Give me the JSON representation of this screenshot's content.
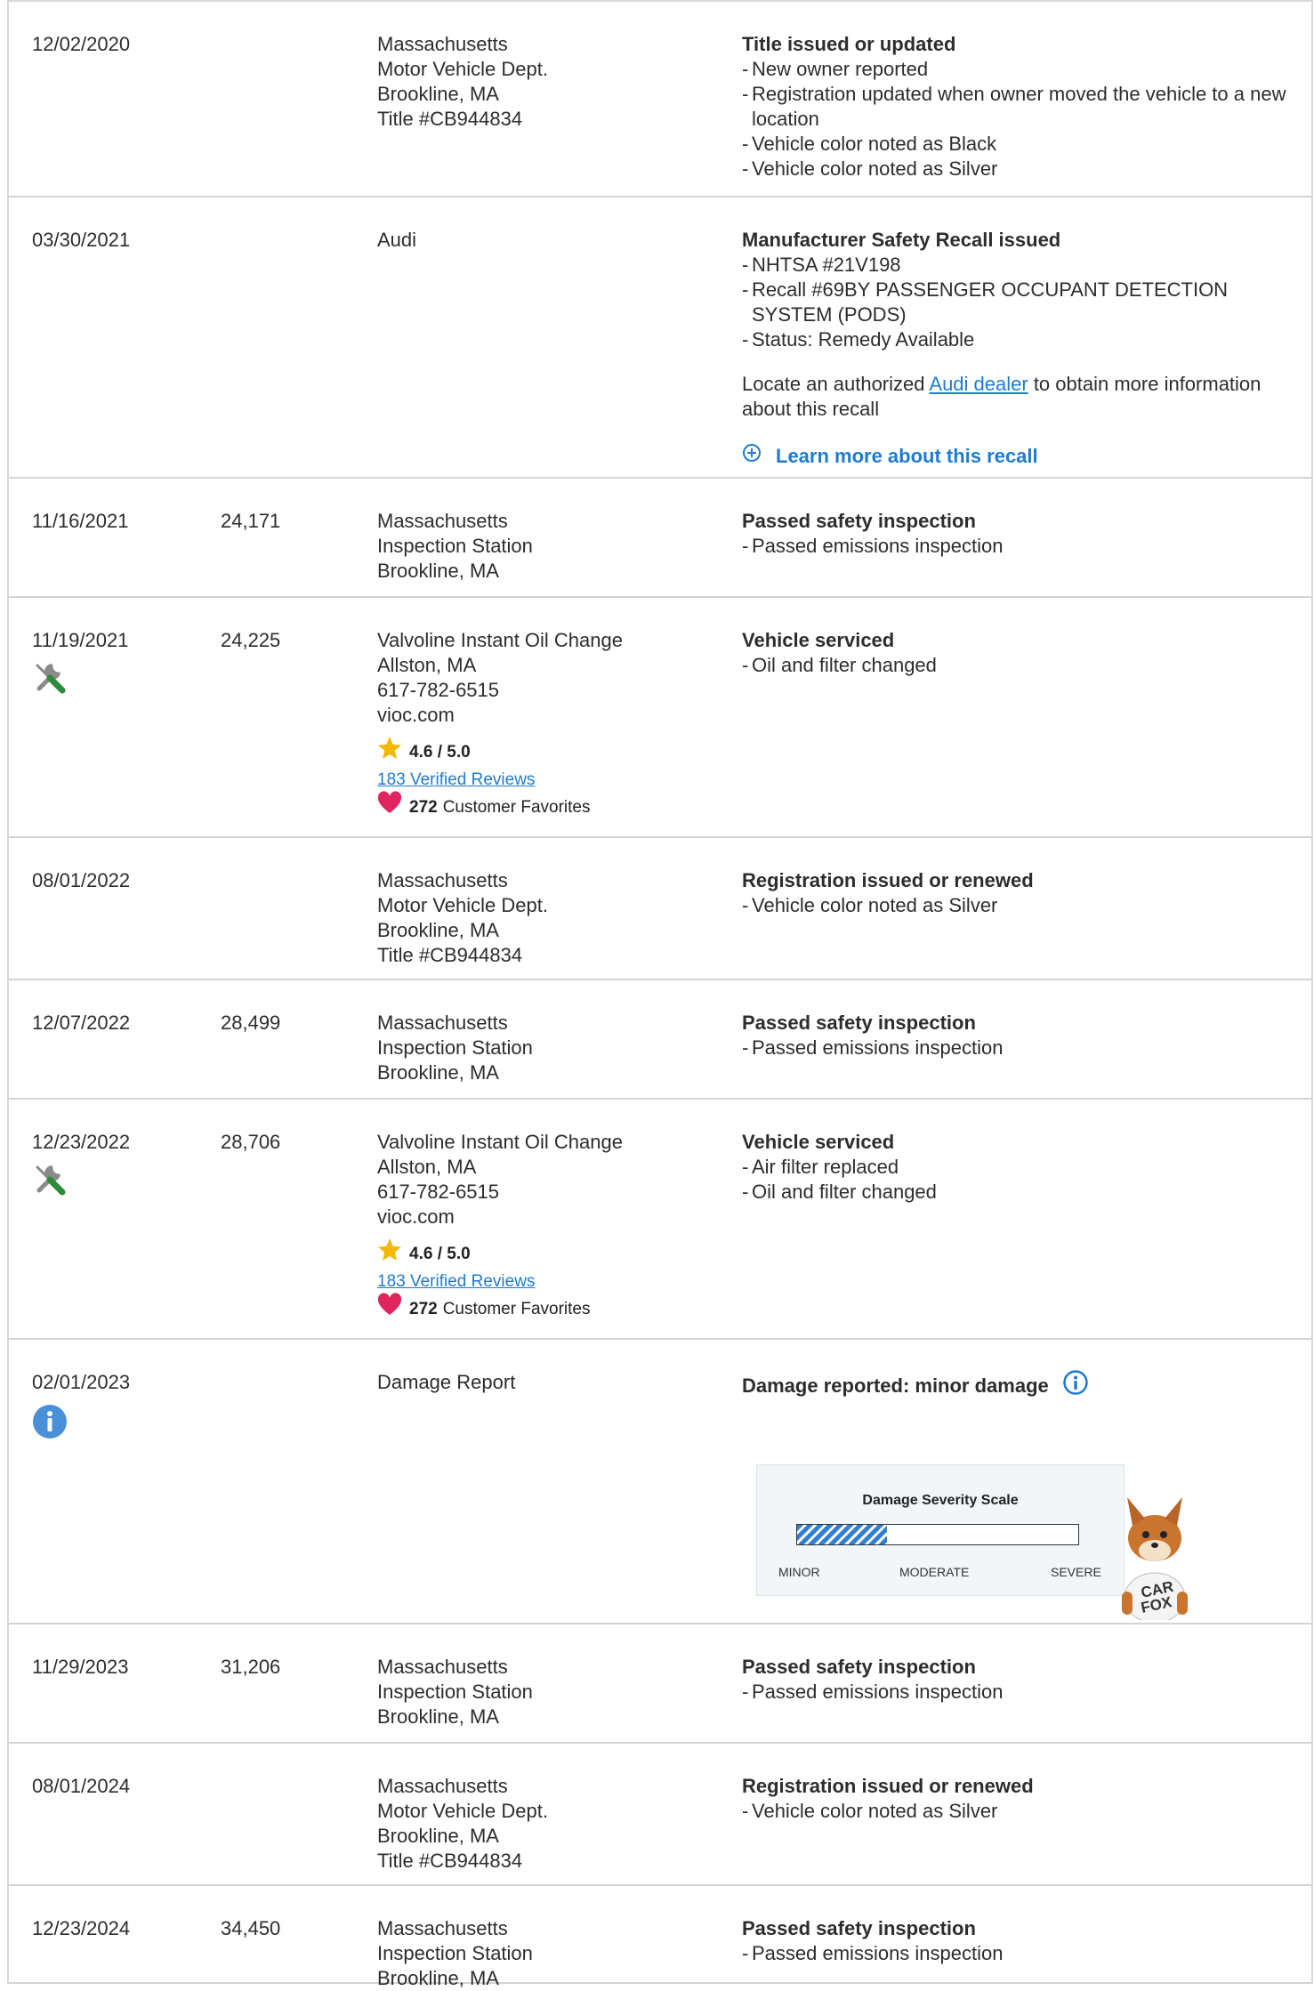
{
  "records": [
    {
      "date": "12/02/2020",
      "odometer": "",
      "source": [
        "Massachusetts",
        "Motor Vehicle Dept.",
        "Brookline, MA",
        "Title #CB944834"
      ],
      "title": "Title issued or updated",
      "details": [
        "New owner reported",
        "Registration updated when owner moved the vehicle to a new location",
        "Vehicle color noted as Black",
        "Vehicle color noted as Silver"
      ]
    },
    {
      "date": "03/30/2021",
      "odometer": "",
      "source": [
        "Audi"
      ],
      "title": "Manufacturer Safety Recall issued",
      "details": [
        "NHTSA #21V198",
        "Recall #69BY PASSENGER OCCUPANT DETECTION SYSTEM (PODS)",
        "Status: Remedy Available"
      ],
      "recall_note": {
        "before": "Locate an authorized ",
        "link": "Audi dealer",
        "after": " to obtain more information about this recall"
      },
      "learn_more": "Learn more about this recall"
    },
    {
      "date": "11/16/2021",
      "odometer": "24,171",
      "source": [
        "Massachusetts",
        "Inspection Station",
        "Brookline, MA"
      ],
      "title": "Passed safety inspection",
      "details": [
        "Passed emissions inspection"
      ]
    },
    {
      "date": "11/19/2021",
      "odometer": "24,225",
      "source": [
        "Valvoline Instant Oil Change",
        "Allston, MA",
        "617-782-6515",
        "vioc.com"
      ],
      "title": "Vehicle serviced",
      "details": [
        "Oil and filter changed"
      ],
      "icon": "service-wrench-icon",
      "rating": {
        "score": "4.6 / 5.0",
        "reviews": "183 Verified Reviews",
        "favorites_count": "272",
        "favorites_label": "Customer Favorites"
      }
    },
    {
      "date": "08/01/2022",
      "odometer": "",
      "source": [
        "Massachusetts",
        "Motor Vehicle Dept.",
        "Brookline, MA",
        "Title #CB944834"
      ],
      "title": "Registration issued or renewed",
      "details": [
        "Vehicle color noted as Silver"
      ]
    },
    {
      "date": "12/07/2022",
      "odometer": "28,499",
      "source": [
        "Massachusetts",
        "Inspection Station",
        "Brookline, MA"
      ],
      "title": "Passed safety inspection",
      "details": [
        "Passed emissions inspection"
      ]
    },
    {
      "date": "12/23/2022",
      "odometer": "28,706",
      "source": [
        "Valvoline Instant Oil Change",
        "Allston, MA",
        "617-782-6515",
        "vioc.com"
      ],
      "title": "Vehicle serviced",
      "details": [
        "Air filter replaced",
        "Oil and filter changed"
      ],
      "icon": "service-wrench-icon",
      "rating": {
        "score": "4.6 / 5.0",
        "reviews": "183 Verified Reviews",
        "favorites_count": "272",
        "favorites_label": "Customer Favorites"
      }
    },
    {
      "date": "02/01/2023",
      "odometer": "",
      "source": [
        "Damage Report"
      ],
      "title": "Damage reported: minor damage",
      "details": [],
      "icon": "info-icon",
      "damage_scale": {
        "title": "Damage Severity Scale",
        "labels": [
          "MINOR",
          "MODERATE",
          "SEVERE"
        ],
        "level": 0.32,
        "mascot": "CAR FOX"
      }
    },
    {
      "date": "11/29/2023",
      "odometer": "31,206",
      "source": [
        "Massachusetts",
        "Inspection Station",
        "Brookline, MA"
      ],
      "title": "Passed safety inspection",
      "details": [
        "Passed emissions inspection"
      ]
    },
    {
      "date": "08/01/2024",
      "odometer": "",
      "source": [
        "Massachusetts",
        "Motor Vehicle Dept.",
        "Brookline, MA",
        "Title #CB944834"
      ],
      "title": "Registration issued or renewed",
      "details": [
        "Vehicle color noted as Silver"
      ]
    },
    {
      "date": "12/23/2024",
      "odometer": "34,450",
      "source": [
        "Massachusetts",
        "Inspection Station",
        "Brookline, MA"
      ],
      "title": "Passed safety inspection",
      "details": [
        "Passed emissions inspection"
      ]
    }
  ],
  "colors": {
    "link": "#1f7bd1",
    "border": "#d4d4d4",
    "star": "#f5b800",
    "heart": "#e0245e",
    "info": "#4a90d9",
    "wrench": "#8a8a8a",
    "screwdriver": "#2e8b3a"
  }
}
